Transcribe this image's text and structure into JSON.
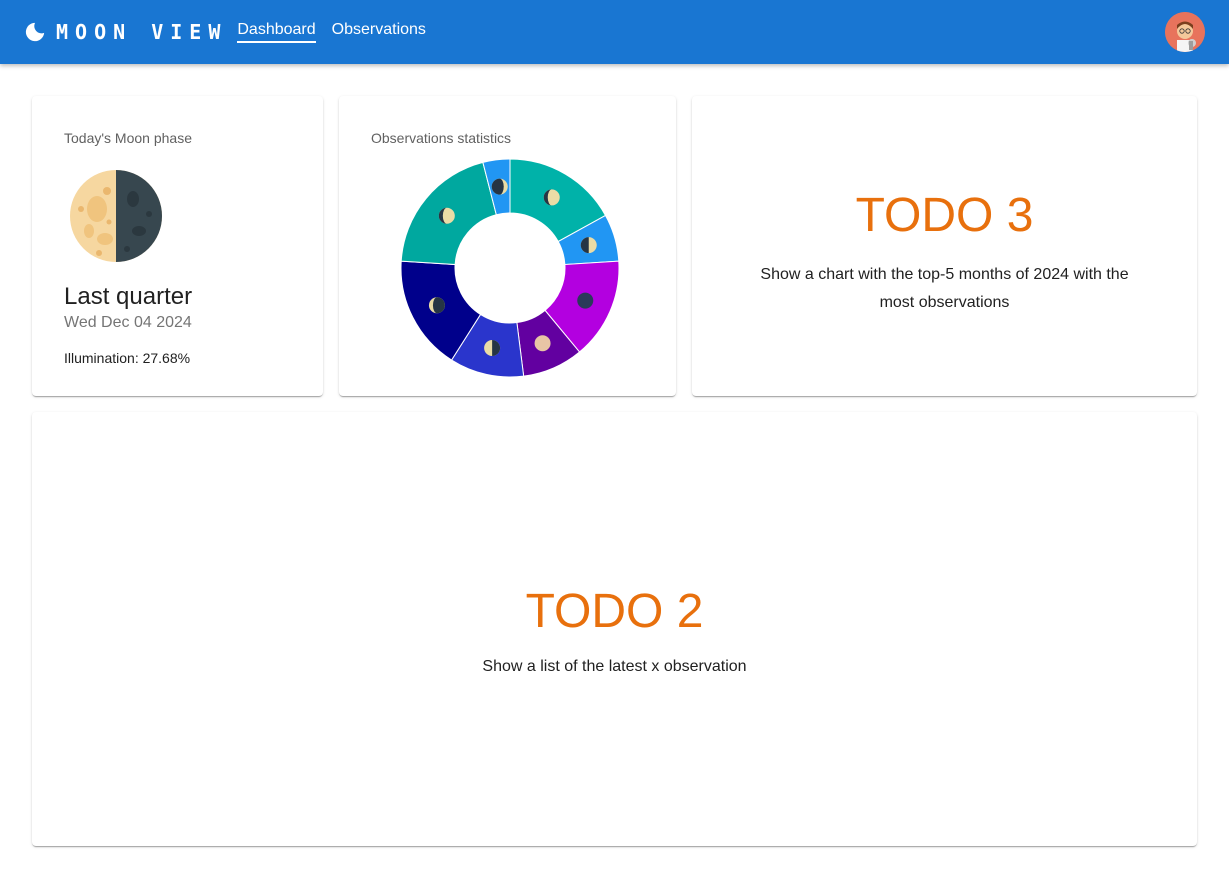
{
  "app": {
    "brand": "MOON VIEW",
    "nav": [
      {
        "label": "Dashboard",
        "active": true
      },
      {
        "label": "Observations",
        "active": false
      }
    ],
    "accent": "#1976d2"
  },
  "moon_card": {
    "title": "Today's Moon phase",
    "phase": "Last quarter",
    "date": "Wed Dec 04 2024",
    "illumination_label": "Illumination: ",
    "illumination_value": "27.68%"
  },
  "stats_card": {
    "title": "Observations statistics"
  },
  "chart_data": {
    "type": "pie",
    "donut": true,
    "segments": [
      {
        "value": 17,
        "color": "#00b2a9",
        "phase_icon": "waxing-gibbous-icon"
      },
      {
        "value": 7,
        "color": "#2196f3",
        "phase_icon": "first-quarter-icon"
      },
      {
        "value": 15,
        "color": "#b300e0",
        "phase_icon": "new-moon-icon"
      },
      {
        "value": 9,
        "color": "#6200a0",
        "phase_icon": "full-moon-icon"
      },
      {
        "value": 11,
        "color": "#2a35cc",
        "phase_icon": "last-quarter-icon"
      },
      {
        "value": 17,
        "color": "#00008b",
        "phase_icon": "waning-crescent-icon"
      },
      {
        "value": 20,
        "color": "#00a89f",
        "phase_icon": "waxing-gibbous-icon"
      },
      {
        "value": 4,
        "color": "#2196f3",
        "phase_icon": "waxing-crescent-icon"
      }
    ]
  },
  "todo3": {
    "title": "TODO 3",
    "description": "Show a chart with the top-5 months of 2024 with the most observations"
  },
  "todo2": {
    "title": "TODO 2",
    "description": "Show a list of the latest x observation"
  }
}
